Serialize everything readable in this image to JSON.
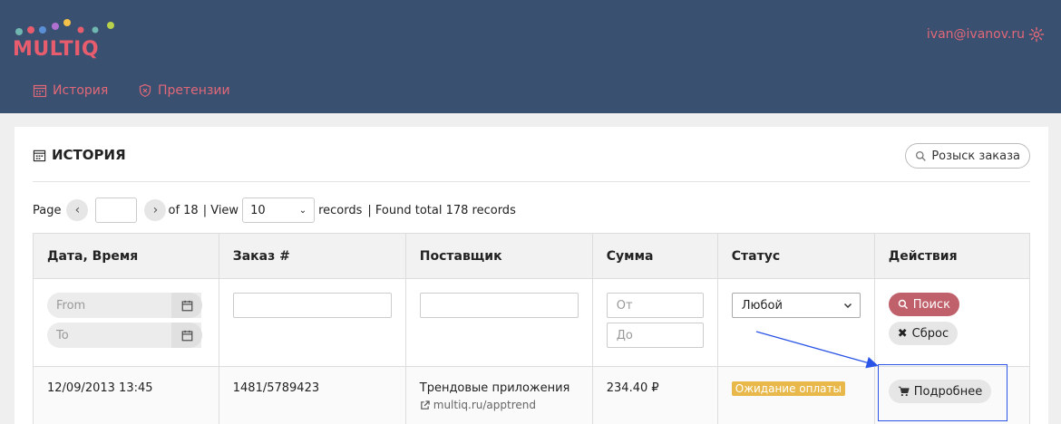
{
  "header": {
    "logo_text": "MULTIQ",
    "user_email": "ivan@ivanov.ru",
    "nav": [
      {
        "label": "История",
        "icon": "calendar-icon"
      },
      {
        "label": "Претензии",
        "icon": "shield-icon"
      }
    ]
  },
  "page": {
    "title": "ИСТОРИЯ",
    "search_order_label": "Розыск заказа"
  },
  "pager": {
    "page_label": "Page",
    "page_value": "",
    "of_text": "of 18",
    "view_label": "| View",
    "view_value": "10",
    "records_label": "records",
    "found_text": "| Found total 178 records"
  },
  "table": {
    "columns": [
      "Дата, Время",
      "Заказ #",
      "Поставщик",
      "Сумма",
      "Статус",
      "Действия"
    ],
    "filters": {
      "date_from_placeholder": "From",
      "date_to_placeholder": "To",
      "sum_from_placeholder": "От",
      "sum_to_placeholder": "До",
      "status_value": "Любой",
      "search_button": "Поиск",
      "reset_button": "Сброс"
    },
    "rows": [
      {
        "datetime": "12/09/2013 13:45",
        "order": "1481/5789423",
        "supplier": "Трендовые приложения",
        "supplier_link": "multiq.ru/apptrend",
        "amount": "234.40 ₽",
        "status": "Ожидание оплаты",
        "action": "Подробнее"
      }
    ]
  },
  "colors": {
    "header_bg": "#3a5070",
    "accent": "#e06878",
    "search_btn": "#c0606b",
    "status_badge": "#e8b84a",
    "annotation": "#2a55e6"
  }
}
